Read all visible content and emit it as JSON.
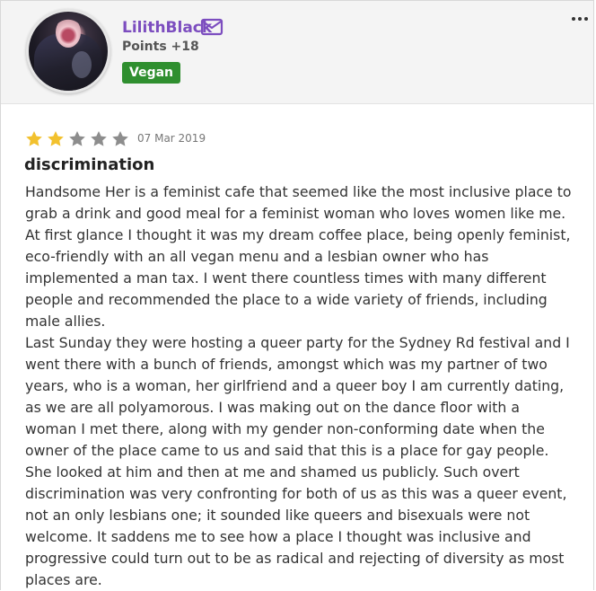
{
  "user": {
    "name": "LilithBlack",
    "points": "Points +18",
    "badge": "Vegan"
  },
  "review": {
    "rating": 2,
    "max_rating": 5,
    "date": "07 Mar 2019",
    "title": "discrimination",
    "paragraphs": [
      "Handsome Her is a feminist cafe that seemed like the most inclusive place to grab a drink and good meal for a feminist woman who loves women like me. At first glance I thought it was my dream coffee place, being openly feminist, eco-friendly with an all vegan menu and a lesbian owner who has implemented a man tax. I went there countless times with many different people and recommended the place to a wide variety of friends, including male allies.",
      "Last Sunday they were hosting a queer party for the Sydney Rd festival and I went there with a bunch of friends, amongst which was my partner of two years, who is a woman, her girlfriend and a queer boy I am currently dating, as we are all polyamorous. I was making out on the dance floor with a woman I met there, along with my gender non-conforming date when the owner of the place came to us and said that this is a place for gay people. She looked at him and then at me and shamed us publicly. Such overt discrimination was very confronting for both of us as this was a queer event, not an only lesbians one; it sounded like queers and bisexuals were not welcome. It saddens me to see how a place I thought was inclusive and progressive could turn out to be as radical and rejecting of diversity as most places are."
    ]
  },
  "icons": {
    "mail": "mail-icon",
    "more": "more-icon",
    "star_filled": "star-filled-icon",
    "star_empty": "star-empty-icon"
  },
  "colors": {
    "username": "#7c4dbf",
    "badge_bg": "#2f8f2f",
    "star_filled": "#f2c12e",
    "star_empty": "#8d8d8d"
  }
}
